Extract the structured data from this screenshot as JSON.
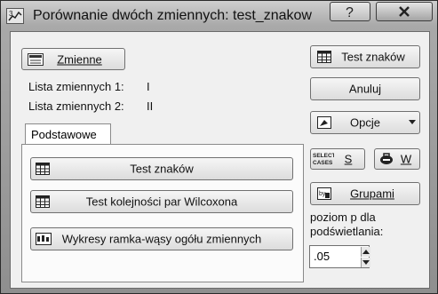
{
  "window": {
    "title": "Porównanie dwóch zmiennych: test_znakow"
  },
  "titlebar_buttons": {
    "help": "?",
    "close": "×"
  },
  "buttons": {
    "zmienne": "Zmienne",
    "test_znakow_top": "Test znaków",
    "anuluj": "Anuluj",
    "opcje": "Opcje",
    "select_cases": "S",
    "select_cases_icon_text": "SELECT CASES",
    "weight": "W",
    "grupami": "Grupami"
  },
  "variables": {
    "list1_label": "Lista zmiennych 1:",
    "list1_value": "I",
    "list2_label": "Lista zmiennych 2:",
    "list2_value": "II"
  },
  "tabs": [
    {
      "label": "Podstawowe",
      "active": true
    }
  ],
  "basic_tab": {
    "test_znakow": "Test znaków",
    "wilcoxon": "Test kolejności par Wilcoxona",
    "boxplot": "Wykresy ramka-wąsy ogółu zmiennych"
  },
  "highlight": {
    "label": "poziom p dla podświetlania:",
    "value": ".05"
  },
  "icons": {
    "app": "statistica-app-icon",
    "help": "help-icon",
    "close": "close-icon",
    "variables": "variables-icon",
    "table": "table-grid-icon",
    "options": "options-icon",
    "select_cases": "select-cases-icon",
    "weight": "weight-icon",
    "by_group": "by-group-icon",
    "boxplot": "boxplot-icon"
  }
}
